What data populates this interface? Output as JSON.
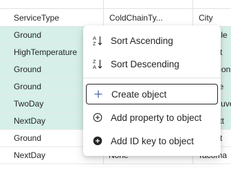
{
  "columns": [
    "ServiceType",
    "ColdChainTy...",
    "City"
  ],
  "rows": [
    {
      "service": "Ground",
      "coldchain": "",
      "city": "Danville",
      "selected": true
    },
    {
      "service": "HighTemperature",
      "coldchain": "",
      "city": "Detroit",
      "selected": true
    },
    {
      "service": "Ground",
      "coldchain": "",
      "city": "Richmond",
      "selected": true
    },
    {
      "service": "Ground",
      "coldchain": "",
      "city": "Seattle",
      "selected": true
    },
    {
      "service": "TwoDay",
      "coldchain": "",
      "city": "Vancouver",
      "selected": true
    },
    {
      "service": "NextDay",
      "coldchain": "",
      "city": "Everett",
      "selected": true
    },
    {
      "service": "Ground",
      "coldchain": "",
      "city": "Detroit",
      "selected": false
    },
    {
      "service": "NextDay",
      "coldchain": "None",
      "city": "Tacoma",
      "selected": false
    }
  ],
  "menu": {
    "sort_asc": "Sort Ascending",
    "sort_desc": "Sort Descending",
    "create_object": "Create object",
    "add_property": "Add property to object",
    "add_id_key": "Add ID key to object"
  }
}
